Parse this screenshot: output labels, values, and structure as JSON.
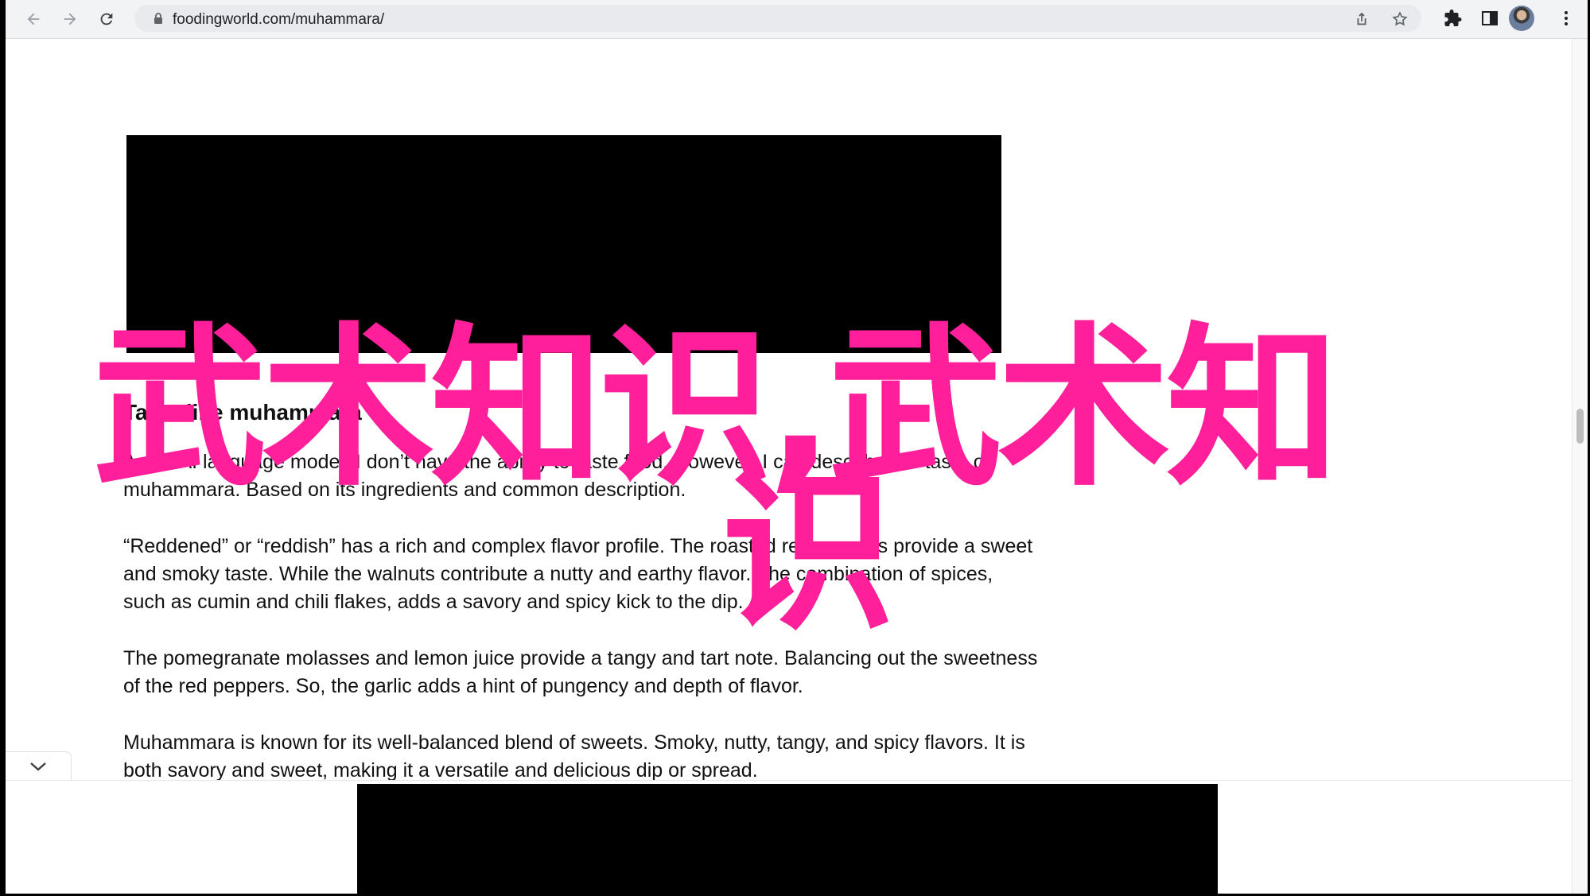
{
  "browser": {
    "url_domain": "foodingworld.com",
    "url_path": "/muhammara/"
  },
  "article": {
    "heading": "Taste like muhammara",
    "paragraphs": [
      "As an AI language model, I don’t have the ability to taste food. However, I can describe the taste of muhammara. Based on its ingredients and common description.",
      "“Reddened” or “reddish” has a rich and complex flavor profile. The roasted red peppers provide a sweet and smoky taste. While the walnuts contribute a nutty and earthy flavor. The combination of spices, such as cumin and chili flakes, adds a savory and spicy kick to the dip.",
      "The pomegranate molasses and lemon juice provide a tangy and tart note. Balancing out the sweetness of the red peppers.  So, the garlic adds a hint of pungency and depth of flavor.",
      "Muhammara is known for its well-balanced blend of sweets. Smoky, nutty, tangy, and spicy flavors. It is both savory and sweet, making it a versatile and delicious dip or spread."
    ]
  },
  "overlay": {
    "line1": "武术知识,武术知",
    "line2": "识",
    "color": "#ff1f9b"
  },
  "icons": {
    "back": "arrow-left-icon",
    "forward": "arrow-right-icon",
    "reload": "reload-icon",
    "lock": "lock-icon",
    "share": "share-icon",
    "bookmark": "star-icon",
    "extensions": "puzzle-icon",
    "sidepanel": "side-panel-icon",
    "menu": "kebab-menu-icon",
    "collapse": "chevron-down-icon"
  }
}
